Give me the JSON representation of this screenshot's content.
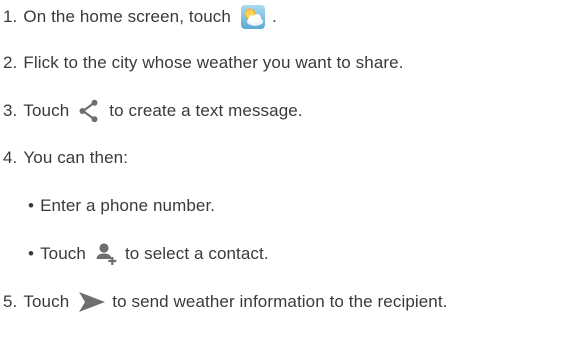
{
  "steps": [
    {
      "number": "1.",
      "before": "On the home screen, touch",
      "icon": "weather-app-icon",
      "after": "."
    },
    {
      "number": "2.",
      "text": "Flick to the city whose weather you want to share."
    },
    {
      "number": "3.",
      "before": "Touch",
      "icon": "share-icon",
      "after": "to create a text message."
    },
    {
      "number": "4.",
      "text": "You can then:"
    },
    {
      "number": "5.",
      "before": "Touch",
      "icon": "send-icon",
      "after": "to send weather information to the recipient."
    }
  ],
  "substeps": [
    {
      "bullet": "•",
      "text": "Enter a phone number."
    },
    {
      "bullet": "•",
      "before": "Touch",
      "icon": "add-contact-icon",
      "after": "to select a contact."
    }
  ],
  "colors": {
    "text": "#3a3a3a",
    "icon_gray": "#6e6e6e",
    "weather_sky": "#7fbcdc",
    "weather_sun": "#f3b23a"
  }
}
